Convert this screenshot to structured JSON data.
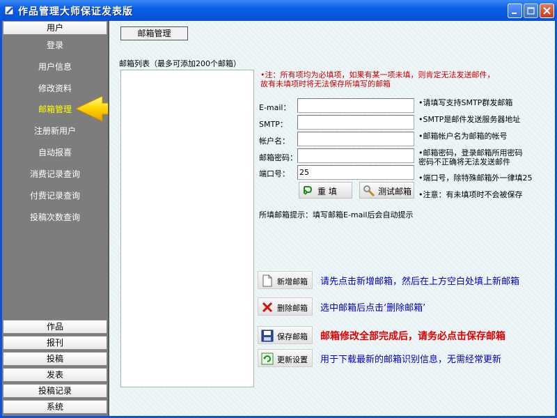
{
  "window": {
    "title": "作品管理大师保证发表版",
    "accent": "#0a5fe6"
  },
  "sidebar": {
    "top_group": "用户",
    "items": [
      {
        "label": "登录"
      },
      {
        "label": "用户信息"
      },
      {
        "label": "修改资料"
      },
      {
        "label": "邮箱管理",
        "active": true
      },
      {
        "label": "注册新用户"
      },
      {
        "label": "自动报喜"
      },
      {
        "label": "消费记录查询"
      },
      {
        "label": "付费记录查询"
      },
      {
        "label": "投稿次数查询"
      }
    ],
    "bottom_groups": [
      "作品",
      "报刊",
      "投稿",
      "发表",
      "投稿记录",
      "系统"
    ],
    "active_color": "#ffff00"
  },
  "main": {
    "tab_label": "邮箱管理",
    "list_label": "邮箱列表（最多可添加200个邮箱）",
    "note_line1": "•注：所有项均为必填项，如果有某一项未填，则肯定无法发送邮件，",
    "note_line2": "故有未填项时将无法保存所填写的邮箱",
    "fields": {
      "email": {
        "label": "E-mail：",
        "value": "",
        "hint": "•请填写支持SMTP群发邮箱"
      },
      "smtp": {
        "label": "SMTP：",
        "value": "",
        "hint": "•SMTP是邮件发送服务器地址"
      },
      "account": {
        "label": "帐户名：",
        "value": "",
        "hint": "•邮箱帐户名为邮箱的帐号"
      },
      "password": {
        "label": "邮箱密码：",
        "value": "",
        "hint_line1": "•邮箱密码，登录邮箱所用密码",
        "hint_line2": " 密码不正确将无法发送邮件"
      },
      "port": {
        "label": "端口号：",
        "value": "25",
        "hint": "•端口号，除特殊邮箱外一律填25"
      }
    },
    "refill_label": "重  填",
    "test_label": "测试邮箱",
    "unsaved_note": "•注意：有未填项时不会被保存",
    "email_tip": "所填邮箱提示：填写邮箱E-mail后会自动提示",
    "add_mailbox": {
      "label": "新增邮箱",
      "instruction": "请先点击新增邮箱，然后在上方空白处填上新邮箱"
    },
    "delete_mailbox": {
      "label": "删除邮箱",
      "instruction": "选中邮箱后点击‘删除邮箱’"
    },
    "save_mailbox": {
      "label": "保存邮箱",
      "instruction": "邮箱修改全部完成后，请务必点击保存邮箱"
    },
    "update_settings": {
      "label": "更新设置",
      "instruction": "用于下载最新的邮箱识别信息，无需经常更新"
    }
  }
}
